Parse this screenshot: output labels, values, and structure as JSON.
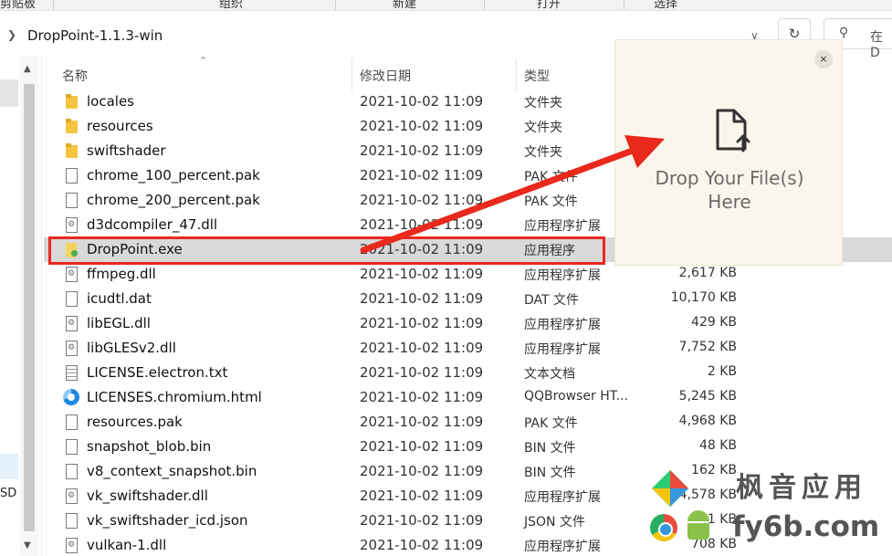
{
  "ribbon": {
    "items": [
      "剪贴板",
      "组织",
      "新建",
      "打开",
      "选择"
    ]
  },
  "address": {
    "path": "DropPoint-1.1.3-win",
    "search_placeholder": "在 D"
  },
  "columns": {
    "name": "名称",
    "date": "修改日期",
    "type": "类型"
  },
  "files": [
    {
      "name": "locales",
      "date": "2021-10-02 11:09",
      "type": "文件夹",
      "size": "",
      "icon": "folder-icon"
    },
    {
      "name": "resources",
      "date": "2021-10-02 11:09",
      "type": "文件夹",
      "size": "",
      "icon": "folder-icon"
    },
    {
      "name": "swiftshader",
      "date": "2021-10-02 11:09",
      "type": "文件夹",
      "size": "",
      "icon": "folder-icon"
    },
    {
      "name": "chrome_100_percent.pak",
      "date": "2021-10-02 11:09",
      "type": "PAK 文件",
      "size": "",
      "icon": "file-icon"
    },
    {
      "name": "chrome_200_percent.pak",
      "date": "2021-10-02 11:09",
      "type": "PAK 文件",
      "size": "",
      "icon": "file-icon"
    },
    {
      "name": "d3dcompiler_47.dll",
      "date": "2021-10-02 11:09",
      "type": "应用程序扩展",
      "size": "",
      "icon": "dll-icon"
    },
    {
      "name": "DropPoint.exe",
      "date": "2021-10-02 11:09",
      "type": "应用程序",
      "size": "",
      "icon": "exe-icon"
    },
    {
      "name": "ffmpeg.dll",
      "date": "2021-10-02 11:09",
      "type": "应用程序扩展",
      "size": "2,617 KB",
      "icon": "dll-icon"
    },
    {
      "name": "icudtl.dat",
      "date": "2021-10-02 11:09",
      "type": "DAT 文件",
      "size": "10,170 KB",
      "icon": "file-icon"
    },
    {
      "name": "libEGL.dll",
      "date": "2021-10-02 11:09",
      "type": "应用程序扩展",
      "size": "429 KB",
      "icon": "dll-icon"
    },
    {
      "name": "libGLESv2.dll",
      "date": "2021-10-02 11:09",
      "type": "应用程序扩展",
      "size": "7,752 KB",
      "icon": "dll-icon"
    },
    {
      "name": "LICENSE.electron.txt",
      "date": "2021-10-02 11:09",
      "type": "文本文档",
      "size": "2 KB",
      "icon": "text-file-icon"
    },
    {
      "name": "LICENSES.chromium.html",
      "date": "2021-10-02 11:09",
      "type": "QQBrowser HT...",
      "size": "5,245 KB",
      "icon": "browser-icon"
    },
    {
      "name": "resources.pak",
      "date": "2021-10-02 11:09",
      "type": "PAK 文件",
      "size": "4,968 KB",
      "icon": "file-icon"
    },
    {
      "name": "snapshot_blob.bin",
      "date": "2021-10-02 11:09",
      "type": "BIN 文件",
      "size": "48 KB",
      "icon": "file-icon"
    },
    {
      "name": "v8_context_snapshot.bin",
      "date": "2021-10-02 11:09",
      "type": "BIN 文件",
      "size": "162 KB",
      "icon": "file-icon"
    },
    {
      "name": "vk_swiftshader.dll",
      "date": "2021-10-02 11:09",
      "type": "应用程序扩展",
      "size": "4,578 KB",
      "icon": "dll-icon"
    },
    {
      "name": "vk_swiftshader_icd.json",
      "date": "2021-10-02 11:09",
      "type": "JSON 文件",
      "size": "1 KB",
      "icon": "file-icon"
    },
    {
      "name": "vulkan-1.dll",
      "date": "2021-10-02 11:09",
      "type": "应用程序扩展",
      "size": "708 KB",
      "icon": "dll-icon"
    }
  ],
  "selected_index": 6,
  "nav": {
    "drive_label": "SD ("
  },
  "drop_widget": {
    "text_line1": "Drop Your File(s)",
    "text_line2": "Here",
    "close_glyph": "×"
  },
  "watermark": {
    "line1": "枫音应用",
    "line2": "fy6b.com"
  },
  "colors": {
    "highlight": "#e8291c",
    "selection": "#d9d9d9",
    "drop_bg": "#fbf6eb"
  }
}
